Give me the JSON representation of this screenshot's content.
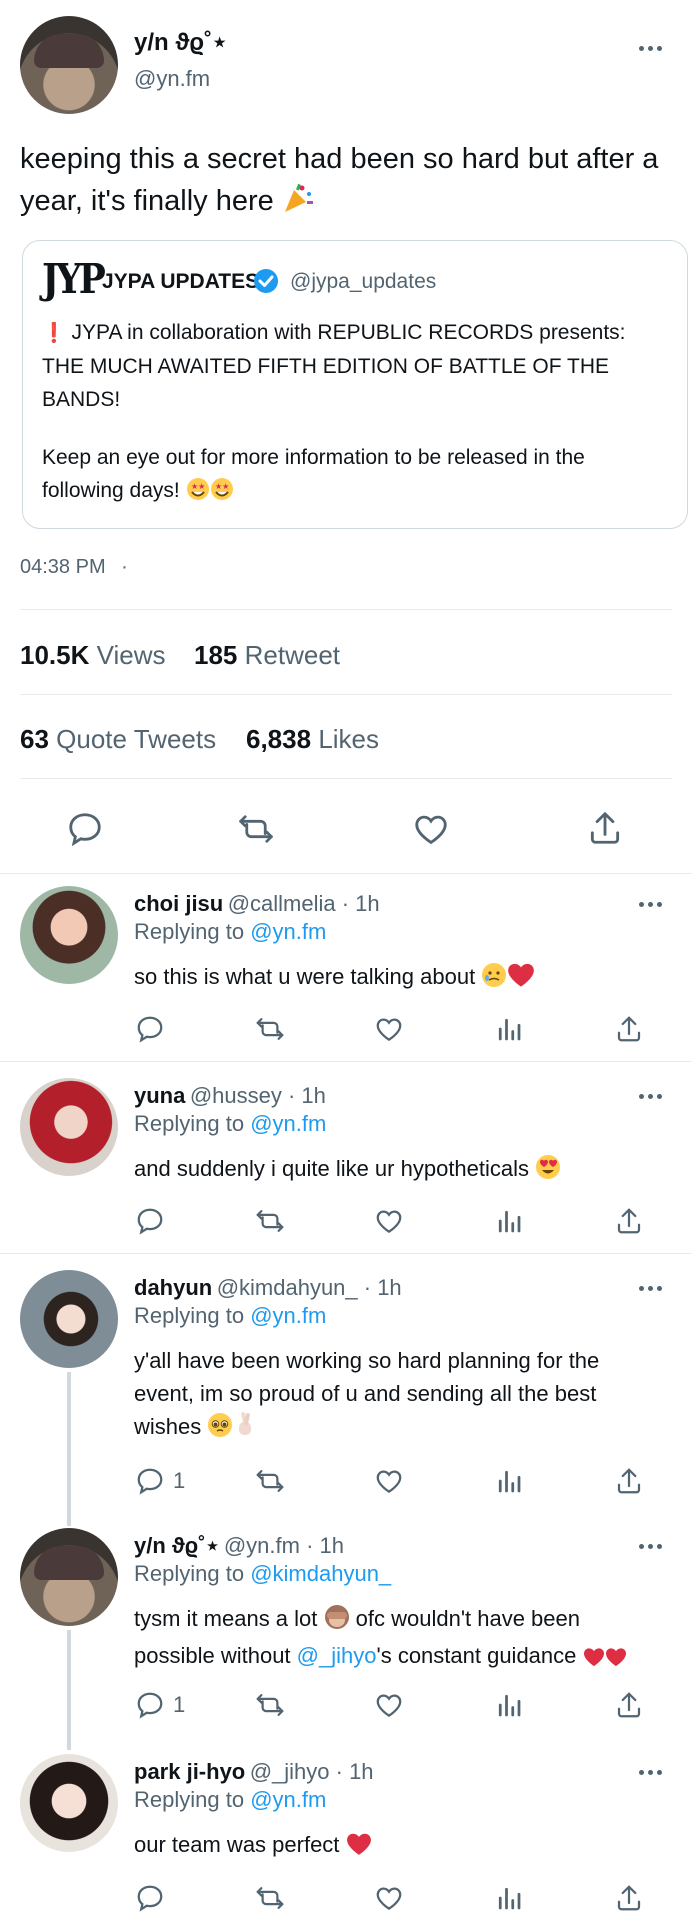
{
  "tweet": {
    "display_name": "y/n ϑϱ˚⋆",
    "handle": "@yn.fm",
    "text": "keeping this a secret had been so hard but after a year, it's finally here",
    "text_emoji": "party-popper",
    "timestamp": "04:38 PM",
    "dot": "·",
    "quote": {
      "logo": "JYP",
      "name": "JYPA UPDATES",
      "handle": "@jypa_updates",
      "line1": "JYPA in collaboration with REPUBLIC RECORDS presents:",
      "line2": "THE MUCH AWAITED FIFTH EDITION OF BATTLE OF THE",
      "line3": "BANDS!",
      "line4": "Keep an eye out for more information to be released in the",
      "line5": "following days!",
      "exclamation": "❗"
    },
    "stats": {
      "views_count": "10.5K",
      "views_label": "Views",
      "retweets_count": "185",
      "retweets_label": "Retweet",
      "quotes_count": "63",
      "quotes_label": "Quote Tweets",
      "likes_count": "6,838",
      "likes_label": "Likes"
    }
  },
  "replies": [
    {
      "name": "choi jisu",
      "meta": "@callmelia · 1h",
      "replying_label": "Replying to",
      "replying_to": "@yn.fm",
      "text": "so this is what u were talking about",
      "reply_count": ""
    },
    {
      "name": "yuna",
      "meta": "@hussey · 1h",
      "replying_label": "Replying to",
      "replying_to": "@yn.fm",
      "text": "and suddenly i quite like ur hypotheticals",
      "reply_count": ""
    },
    {
      "name": "dahyun",
      "meta": "@kimdahyun_ · 1h",
      "replying_label": "Replying to",
      "replying_to": "@yn.fm",
      "text_line1": "y'all have been working so hard planning for the",
      "text_line2": "event, im so proud of u and sending all the best",
      "text_line3": "wishes",
      "reply_count": "1"
    },
    {
      "name": "y/n ϑϱ˚⋆",
      "meta": "@yn.fm · 1h",
      "replying_label": "Replying to",
      "replying_to": "@kimdahyun_",
      "text_line1a": "tysm it means a lot",
      "text_line1b": "ofc wouldn't have been",
      "text_line2a": "possible without",
      "mention": "@_jihyo",
      "text_line2b": "'s constant guidance",
      "reply_count": "1"
    },
    {
      "name": "park ji-hyo",
      "meta": "@_jihyo · 1h",
      "replying_label": "Replying to",
      "replying_to": "@yn.fm",
      "text": "our team was perfect",
      "reply_count": ""
    }
  ],
  "colors": {
    "accent": "#1d9bf0",
    "text": "#0f1419",
    "muted": "#536471",
    "divider": "#e6ecf0",
    "heart": "#e0245e"
  }
}
